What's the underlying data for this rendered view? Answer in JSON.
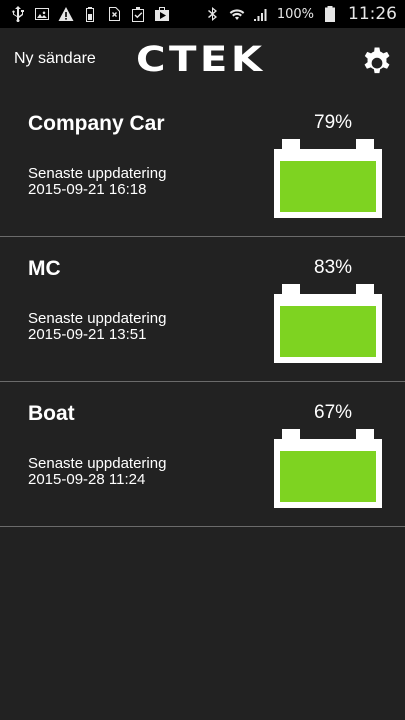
{
  "status_bar": {
    "battery_text": "100%",
    "time": "11:26",
    "left_icons": [
      "usb-icon",
      "image-icon",
      "warning-icon",
      "battery-saver-icon",
      "sim-blocked-icon",
      "clipboard-check-icon",
      "play-store-icon"
    ],
    "right_icons": [
      "bluetooth-icon",
      "wifi-icon",
      "signal-icon",
      "battery-icon"
    ]
  },
  "header": {
    "new_sender_label": "Ny sändare",
    "logo_text": "CTEK",
    "settings_icon": "gear-icon"
  },
  "colors": {
    "background": "#222222",
    "charge_fill": "#7ed321",
    "battery_frame": "#ffffff",
    "divider": "#6b6b6b"
  },
  "devices": [
    {
      "name": "Company Car",
      "updated_label": "Senaste uppdatering",
      "updated_time": "2015-09-21 16:18",
      "percent_text": "79%"
    },
    {
      "name": "MC",
      "updated_label": "Senaste uppdatering",
      "updated_time": "2015-09-21 13:51",
      "percent_text": "83%"
    },
    {
      "name": "Boat",
      "updated_label": "Senaste uppdatering",
      "updated_time": "2015-09-28 11:24",
      "percent_text": "67%"
    }
  ]
}
